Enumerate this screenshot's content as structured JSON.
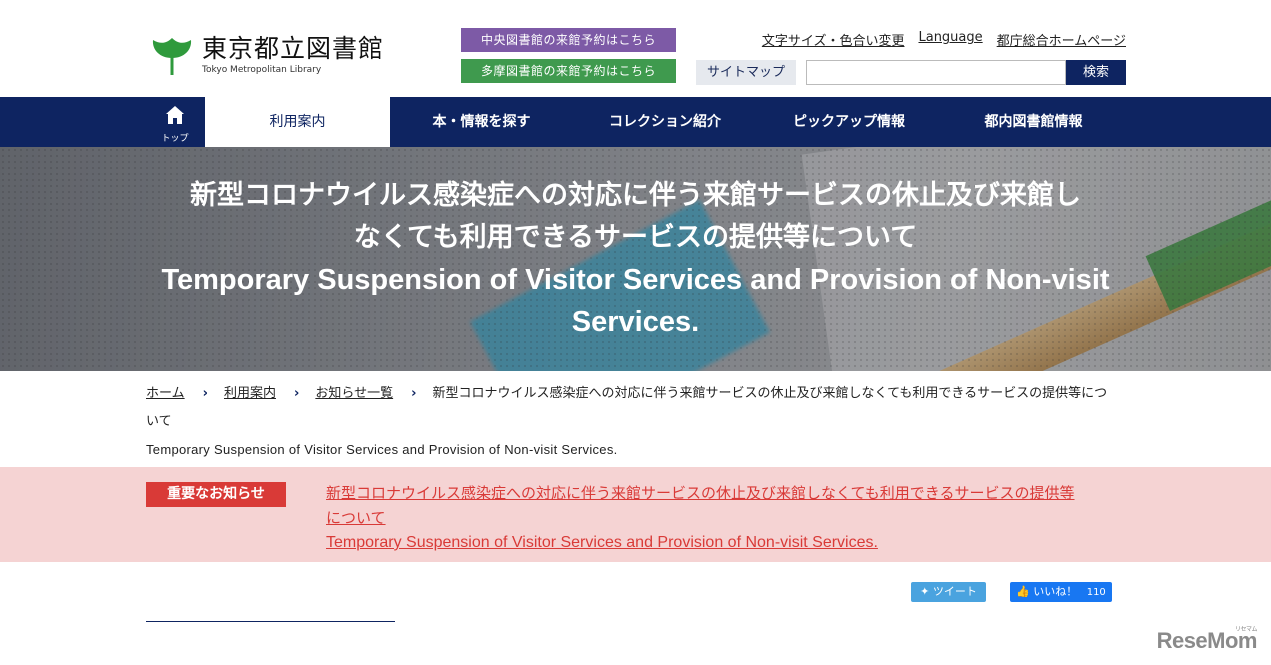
{
  "header": {
    "logo_ja": "東京都立図書館",
    "logo_en": "Tokyo Metropolitan Library",
    "reserve_central": "中央図書館の来館予約はこちら",
    "reserve_tama": "多摩図書館の来館予約はこちら",
    "util_links": [
      "文字サイズ・色合い変更",
      "Language",
      "都庁総合ホームページ"
    ],
    "sitemap": "サイトマップ",
    "search_placeholder": "",
    "search_button": "検索",
    "colors": {
      "brand": "#0e2461",
      "central": "#7d5aa6",
      "tama": "#3f9a4e"
    }
  },
  "nav": {
    "home_label": "トップ",
    "items": [
      "利用案内",
      "本・情報を探す",
      "コレクション紹介",
      "ピックアップ情報",
      "都内図書館情報"
    ],
    "active_index": 0
  },
  "hero": {
    "title_ja_line1": "新型コロナウイルス感染症への対応に伴う来館サービスの休止及び来館し",
    "title_ja_line2": "なくても利用できるサービスの提供等について",
    "title_en_line1": "Temporary Suspension of Visitor Services and Provision of Non-visit",
    "title_en_line2": "Services."
  },
  "breadcrumb": {
    "items": [
      "ホーム",
      "利用案内",
      "お知らせ一覧"
    ],
    "current_ja_1": "新型コロナウイルス感染症への対応に伴う来館サービスの休止及び来館しなくても利用できるサービスの提供等につ",
    "current_ja_2": "いて",
    "current_en": "Temporary Suspension of Visitor Services and Provision of Non-visit Services."
  },
  "notice": {
    "badge": "重要なお知らせ",
    "link_ja_1": "新型コロナウイルス感染症への対応に伴う来館サービスの休止及び来館しなくても利用できるサービスの提供等",
    "link_ja_2": "について",
    "link_en": "Temporary Suspension of Visitor Services and Provision of Non-visit Services.",
    "colors": {
      "background": "#f5d3d3",
      "accent": "#d93a37"
    }
  },
  "social": {
    "tweet": "ツイート",
    "like": "いいね！",
    "like_count": "110"
  },
  "watermark": {
    "text": "ReseMom",
    "small": "リセマム"
  }
}
